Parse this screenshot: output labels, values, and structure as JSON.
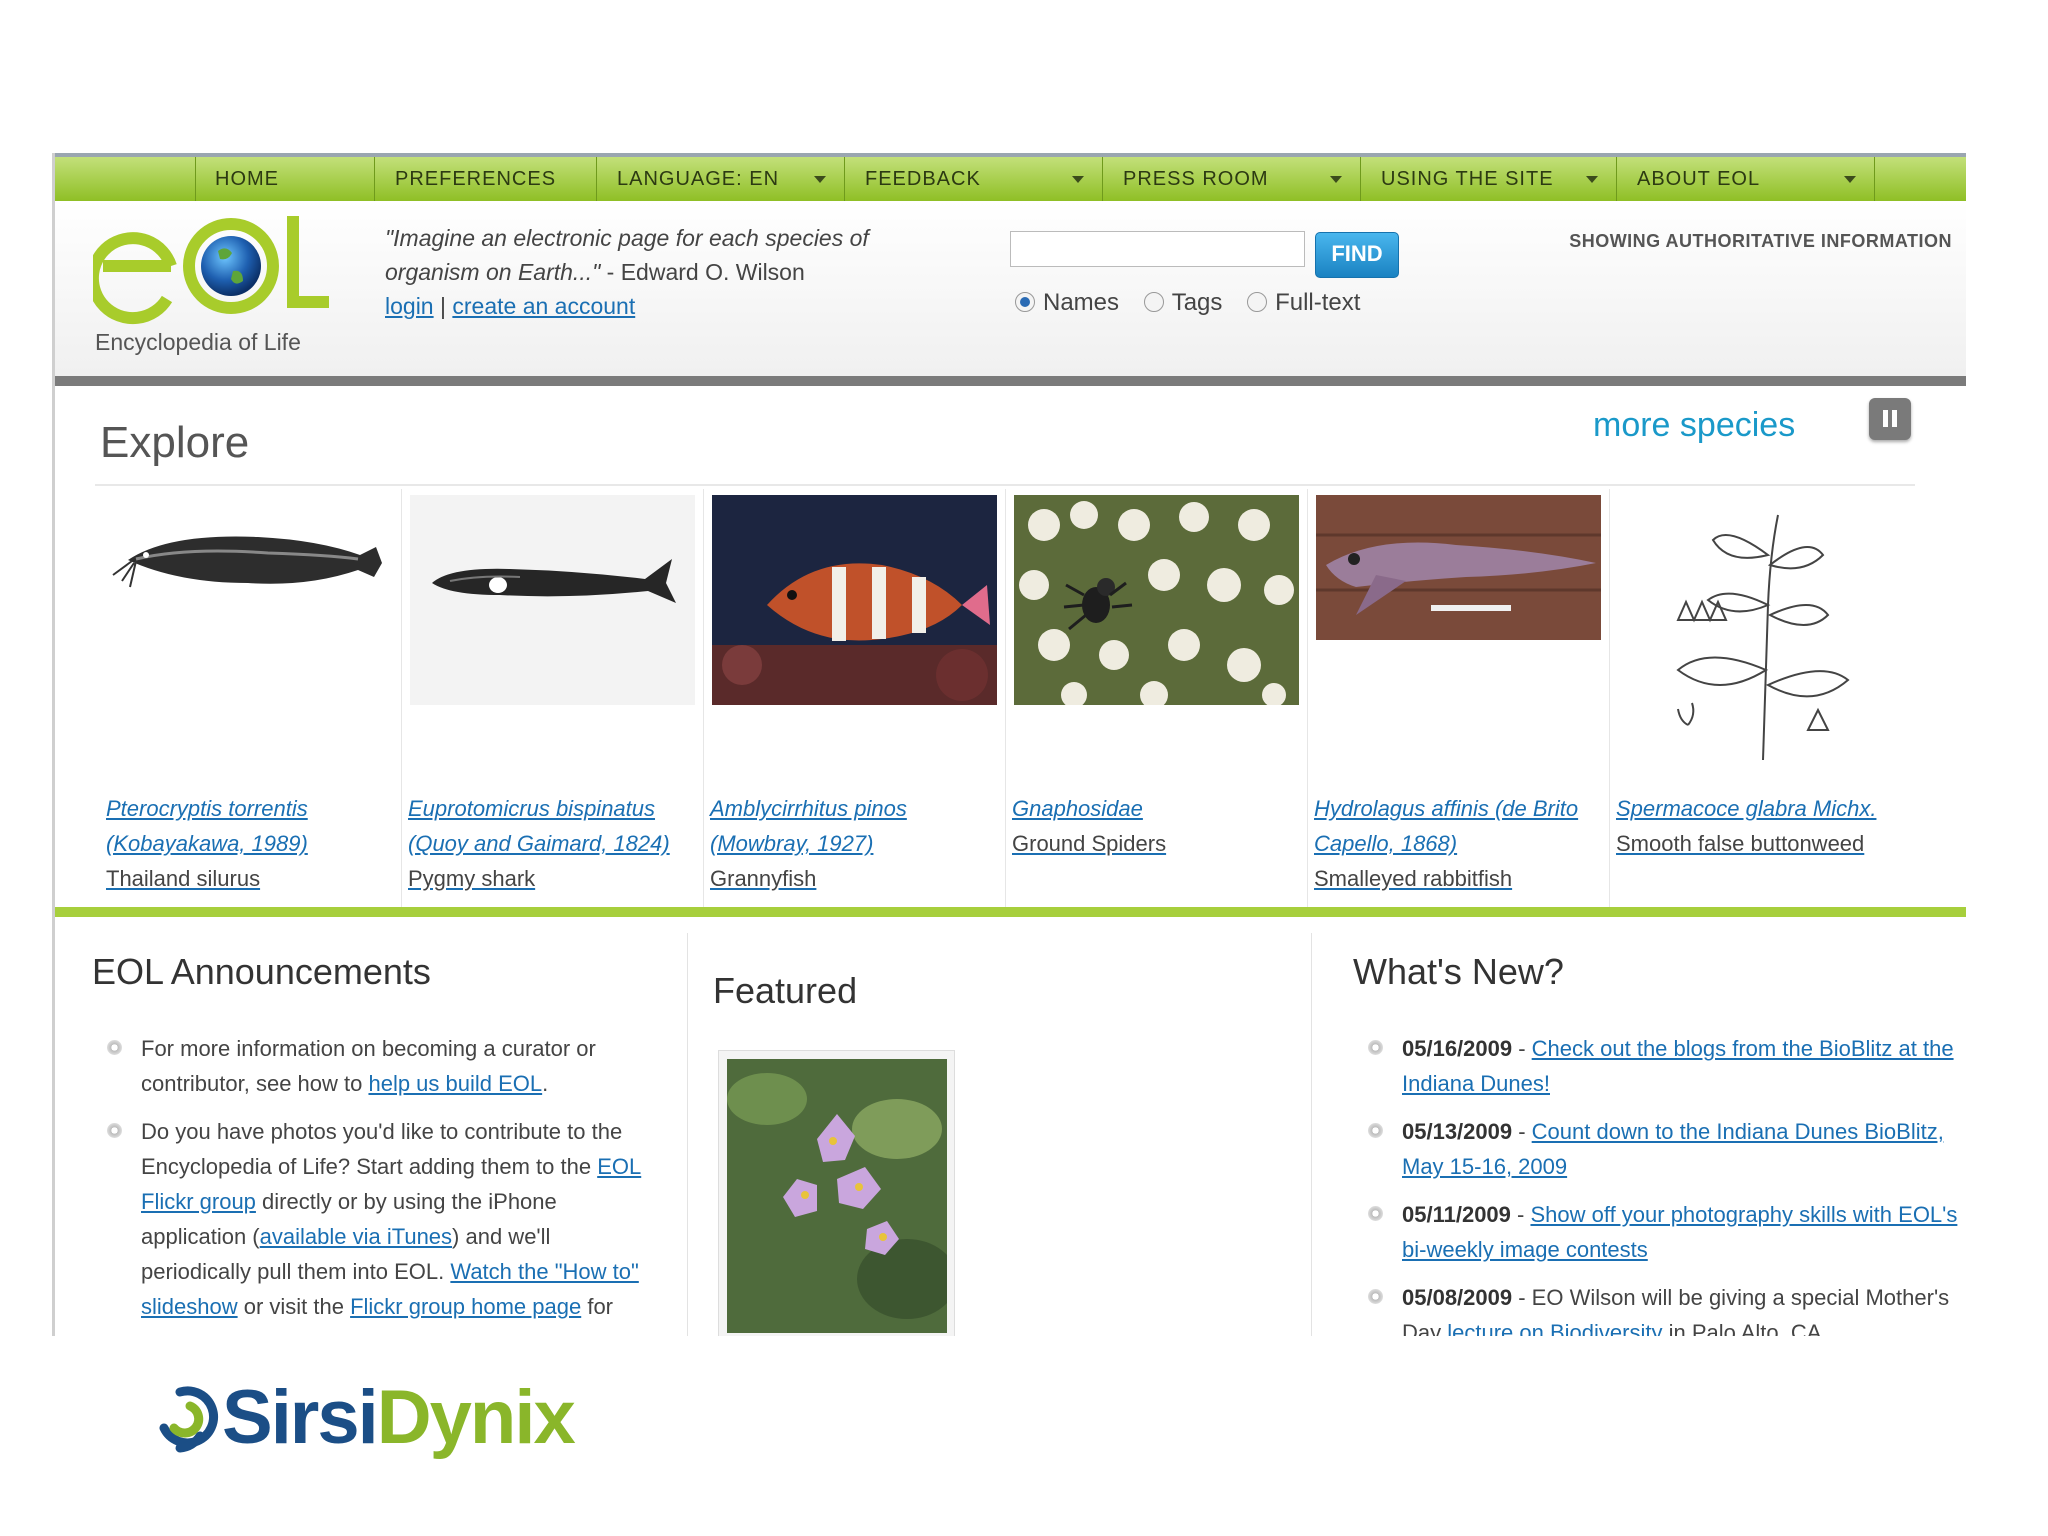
{
  "nav": [
    "HOME",
    "PREFERENCES",
    "LANGUAGE: EN",
    "FEEDBACK",
    "PRESS ROOM",
    "USING THE SITE",
    "ABOUT EOL"
  ],
  "logo": {
    "text": "Encyclopedia of Life",
    "mark": "eol"
  },
  "quote": {
    "text": "\"Imagine an electronic page for each species of organism on Earth...\"",
    "author": " - Edward O. Wilson"
  },
  "auth": {
    "login": "login",
    "sep": " | ",
    "create": "create an account"
  },
  "search": {
    "value": "",
    "find": "FIND",
    "options": [
      "Names",
      "Tags",
      "Full-text"
    ],
    "selected": "Names"
  },
  "showing": "SHOWING AUTHORITATIVE INFORMATION",
  "explore": {
    "title": "Explore",
    "more": "more species",
    "species": [
      {
        "sci": "Pterocryptis torrentis (Kobayakawa, 1989)",
        "common": "Thailand silurus"
      },
      {
        "sci": "Euprotomicrus bispinatus (Quoy and Gaimard, 1824)",
        "common": "Pygmy shark"
      },
      {
        "sci": "Amblycirrhitus pinos (Mowbray, 1927)",
        "common": "Grannyfish"
      },
      {
        "sci": "Gnaphosidae",
        "common": "Ground Spiders"
      },
      {
        "sci": "Hydrolagus affinis (de Brito Capello, 1868)",
        "common": "Smalleyed rabbitfish"
      },
      {
        "sci": "Spermacoce glabra Michx.",
        "common": "Smooth false buttonweed"
      }
    ]
  },
  "announcements": {
    "title": "EOL Announcements",
    "a1": {
      "pre": "For more information on becoming a curator or contributor, see how to ",
      "link": "help us build EOL",
      "post": "."
    },
    "a2": {
      "p1": "Do you have photos you'd like to contribute to the Encyclopedia of Life? Start adding them to the ",
      "l1": "EOL Flickr group",
      "p2": " directly or by using the iPhone application (",
      "l2": "available via iTunes",
      "p3": ") and we'll periodically pull them into EOL. ",
      "l3": "Watch the \"How to\" slideshow",
      "p4": " or visit the ",
      "l4": "Flickr group home page",
      "p5": " for"
    }
  },
  "featured": {
    "title": "Featured"
  },
  "whatsnew": {
    "title": "What's New?",
    "items": [
      {
        "date": "05/16/2009",
        "sep": " - ",
        "link": "Check out the blogs from the BioBlitz at the Indiana Dunes!"
      },
      {
        "date": "05/13/2009",
        "sep": " - ",
        "link": "Count down to the Indiana Dunes BioBlitz, May 15-16, 2009"
      },
      {
        "date": "05/11/2009",
        "sep": " - ",
        "link": "Show off your photography skills with EOL's bi-weekly image contests"
      },
      {
        "date": "05/08/2009",
        "sep": " - ",
        "pre": "EO Wilson will be giving a special Mother's Day ",
        "link": "lecture on Biodiversity",
        "post": " in Palo Alto, CA"
      }
    ]
  },
  "footer": {
    "brand": "SirsiDynix"
  },
  "colors": {
    "nav_green": "#8fbf25",
    "link": "#1a6fb3",
    "more_species": "#1a99c9",
    "eol_green": "#a8cc2b",
    "sirsi_blue": "#1b4e86",
    "sirsi_green": "#8ab62a"
  }
}
